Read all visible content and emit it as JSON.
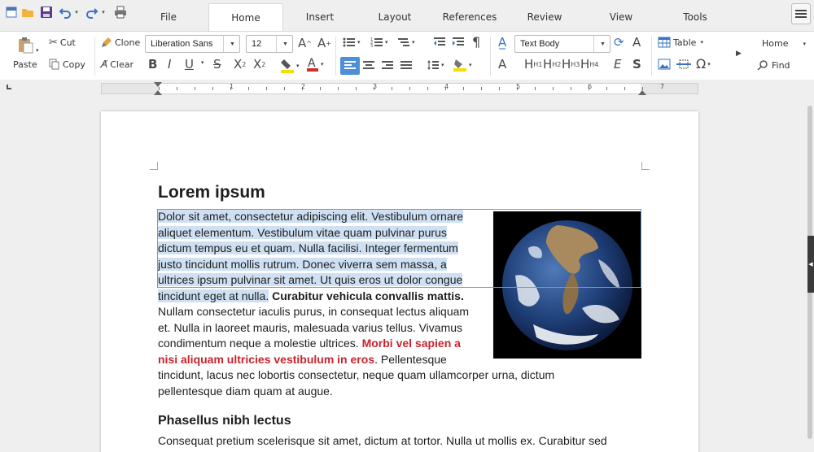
{
  "tabs": [
    "File",
    "Home",
    "Insert",
    "Layout",
    "References",
    "Review",
    "View",
    "Tools"
  ],
  "active_tab": "Home",
  "ribbon": {
    "cut": "Cut",
    "copy": "Copy",
    "paste": "Paste",
    "clone": "Clone",
    "clear": "Clear",
    "font_name": "Liberation Sans",
    "font_size": "12",
    "paragraph_style": "Text Body",
    "table": "Table",
    "home": "Home",
    "find": "Find",
    "heading_buttons": [
      "H1",
      "H2",
      "H3",
      "H4"
    ]
  },
  "ruler_numbers": [
    "1",
    "2",
    "3",
    "4",
    "5",
    "6",
    "7"
  ],
  "document": {
    "heading": "Lorem ipsum",
    "paragraph_lines": [
      [
        "Dolor sit amet, consectetur adipiscing elit. Vestibulum ornare"
      ],
      [
        "aliquet elementum. Vestibulum vitae quam pulvinar purus"
      ],
      [
        "dictum tempus eu et quam. Nulla facilisi. Integer fermentum"
      ],
      [
        "justo tincidunt mollis rutrum. Donec viverra sem massa, a"
      ],
      [
        "ultrices ipsum pulvinar sit amet. Ut quis eros ut dolor congue"
      ]
    ],
    "line6_selected": "tincidunt eget at nulla.",
    "line6_bold": "Curabitur vehicula convallis mattis.",
    "line7": "Nullam consectetur iaculis purus, in consequat lectus aliquam",
    "line8": "et. Nulla in laoreet mauris, malesuada varius tellus. Vivamus",
    "line9_normal": "condimentum neque a molestie ultrices.",
    "line9_red": "Morbi vel sapien a",
    "line10_red": "nisi aliquam ultricies vestibulum in eros",
    "line10_normal": ". Pellentesque",
    "line11": "tincidunt, lacus nec lobortis consectetur, neque quam ullamcorper urna, dictum",
    "line12": "pellentesque diam quam at augue.",
    "subheading": "Phasellus nibh lectus",
    "paragraph2_first_line": "Consequat pretium scelerisque sit amet, dictum at tortor. Nulla ut mollis ex. Curabitur sed"
  },
  "colors": {
    "selection": "#cfe0f3",
    "emphasis_red": "#c8242c",
    "highlight_yellow": "#f4e000",
    "font_red": "#d42a2a",
    "active_button": "#4d8fd8"
  }
}
